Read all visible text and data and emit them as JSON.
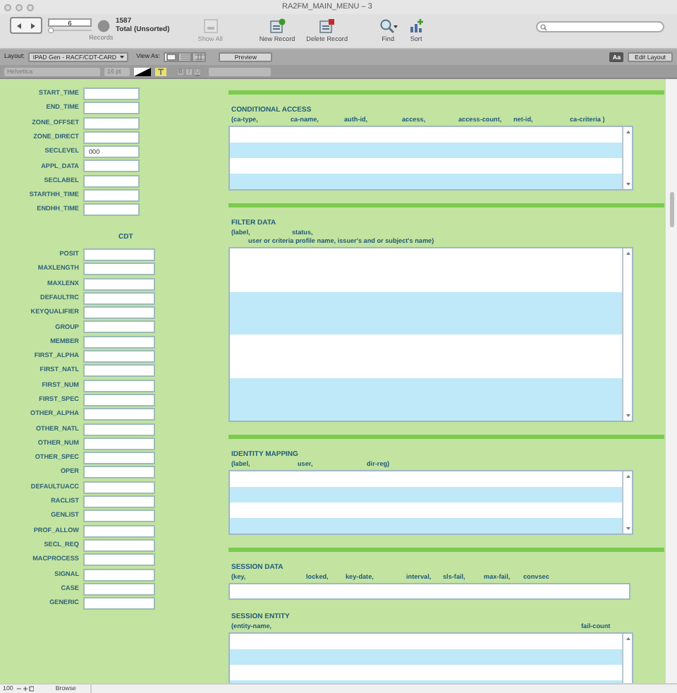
{
  "window": {
    "title": "RA2FM_MAIN_MENU – 3"
  },
  "toolbar": {
    "record_number": "6",
    "record_slider": {
      "level": 0.004
    },
    "record_count": "1587",
    "found_label": "Total (Unsorted)",
    "records_label": "Records",
    "buttons": [
      {
        "label": "Show All",
        "kind": "showall",
        "disabled": true
      },
      {
        "label": "New Record",
        "kind": "new",
        "disabled": false
      },
      {
        "label": "Delete Record",
        "kind": "delete",
        "disabled": false
      },
      {
        "label": "Find",
        "kind": "find",
        "disabled": false
      },
      {
        "label": "Sort",
        "kind": "sort",
        "disabled": false
      }
    ]
  },
  "layout_bar": {
    "layout_label": "Layout:",
    "layout": "IPAD Gen - RACF/CDT-CARD",
    "view_as_label": "View As:",
    "view_modes": [
      {
        "kind": "form",
        "selected": true
      },
      {
        "kind": "list",
        "selected": false
      },
      {
        "kind": "table",
        "selected": false
      }
    ],
    "preview": "Preview",
    "aa": "Aa",
    "edit_layout": "Edit Layout"
  },
  "format_bar": {
    "font": "Helvetica",
    "size": "16 pt",
    "styles": [
      "B",
      "I",
      "U"
    ]
  },
  "fields": [
    {
      "label": "START_TIME"
    },
    {
      "label": "END_TIME"
    },
    {
      "label": "ZONE_OFFSET"
    },
    {
      "label": "ZONE_DIRECT"
    },
    {
      "label": "SECLEVEL",
      "value": "000"
    },
    {
      "label": "APPL_DATA"
    },
    {
      "label": "SECLABEL"
    },
    {
      "label": "STARTHH_TIME"
    },
    {
      "label": "ENDHH_TIME"
    }
  ],
  "cdt": {
    "title": "CDT",
    "fields": [
      "POSIT",
      "MAXLENGTH",
      "MAXLENX",
      "DEFAULTRC",
      "KEYQUALIFIER",
      "GROUP",
      "MEMBER",
      "FIRST_ALPHA",
      "FIRST_NATL",
      "FIRST_NUM",
      "FIRST_SPEC",
      "OTHER_ALPHA",
      "OTHER_NATL",
      "OTHER_NUM",
      "OTHER_SPEC",
      "OPER",
      "DEFAULTUACC",
      "RACLIST",
      "GENLIST",
      "PROF_ALLOW",
      "SECL_REQ",
      "MACPROCESS",
      "SIGNAL",
      "CASE",
      "GENERIC"
    ]
  },
  "sections": [
    {
      "title": "CONDITIONAL ACCESS",
      "kind": "portal",
      "divider": true,
      "header": [
        [
          "(ca-type,",
          "ca-name,",
          "auth-id,",
          "access,",
          "access-count,",
          "net-id,",
          "ca-criteria )"
        ]
      ]
    },
    {
      "title": "FILTER DATA",
      "kind": "tall_portal",
      "divider": true,
      "header": [
        [
          "(label,",
          "status,"
        ],
        [
          "user or criteria profile name, issuer's and or subject's name)"
        ]
      ]
    },
    {
      "title": "IDENTITY MAPPING",
      "kind": "portal",
      "divider": true,
      "header": [
        [
          "(label,",
          "user,",
          "dir-reg)"
        ]
      ]
    },
    {
      "title": "SESSION DATA",
      "kind": "field",
      "divider": true,
      "header": [
        [
          "(key,",
          "locked,",
          "key-date,",
          "interval,",
          "sls-fail,",
          "max-fail,",
          "convsec"
        ]
      ]
    },
    {
      "title": "SESSION ENTITY",
      "kind": "cut_portal",
      "divider": false,
      "header": [
        [
          "(entity-name,",
          "fail-count"
        ]
      ]
    }
  ],
  "status_bar": {
    "zoom": "100",
    "mode": "Browse"
  }
}
